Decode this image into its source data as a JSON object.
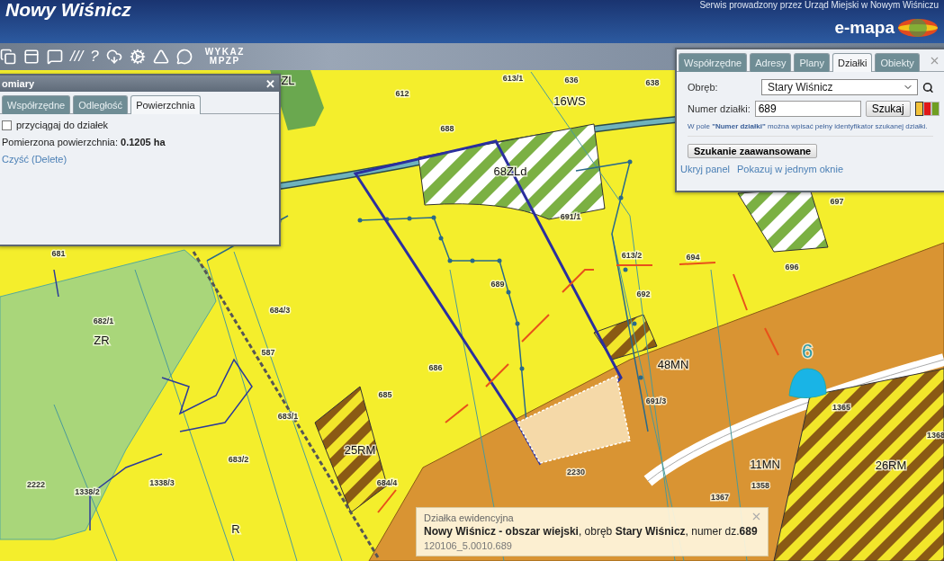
{
  "header": {
    "title": "Nowy Wiśnicz",
    "subtitle": "Serwis prowadzony przez Urząd Miejski w Nowym Wiśniczu",
    "logo": "e-mapa"
  },
  "toolbar": {
    "items": [
      {
        "kind": "icon"
      },
      {
        "kind": "icon"
      },
      {
        "kind": "icon"
      },
      {
        "kind": "glyph",
        "text": "///"
      },
      {
        "kind": "glyph",
        "text": "?"
      },
      {
        "kind": "icon"
      },
      {
        "kind": "icon"
      },
      {
        "kind": "icon"
      },
      {
        "kind": "icon"
      }
    ],
    "label": [
      "WYKAZ",
      "MPZP"
    ]
  },
  "measure_panel": {
    "title": "omiary",
    "close": "✕",
    "tabs": [
      {
        "label": "Współrzędne",
        "selected": false
      },
      {
        "label": "Odległość",
        "selected": false
      },
      {
        "label": "Powierzchnia",
        "selected": true
      }
    ],
    "snap": {
      "label": "przyciągaj do działek",
      "checked": false
    },
    "result": "Pomierzona powierzchnia: **0.1205 ha**",
    "clear_link": "Czyść (Delete)"
  },
  "search_panel": {
    "tabs": [
      {
        "label": "Współrzędne",
        "selected": false
      },
      {
        "label": "Adresy",
        "selected": false
      },
      {
        "label": "Plany",
        "selected": false
      },
      {
        "label": "Działki",
        "selected": true
      },
      {
        "label": "Obiekty",
        "selected": false
      }
    ],
    "district_label": "Obręb:",
    "district_value": "Stary Wiśnicz",
    "number_label": "Numer działki:",
    "number_value": "689",
    "search_button": "Szukaj",
    "color_options": [
      {
        "color": "#f2c23a",
        "selected": true
      },
      {
        "color": "#e01818",
        "selected": false
      },
      {
        "color": "#6f9e22",
        "selected": false
      }
    ],
    "hint": "W pole **\"Numer działki\"** można wpisać pełny identyfikator szukanej działki.",
    "advanced_button": "Szukanie zaawansowane",
    "links": [
      "Ukryj panel",
      "Pokazuj w jednym oknie"
    ]
  },
  "map": {
    "labels": [
      {
        "kind": "zone",
        "text": "ZL"
      },
      {
        "kind": "parcel",
        "text": "612"
      },
      {
        "kind": "parcel",
        "text": "613/1"
      },
      {
        "kind": "parcel",
        "text": "636"
      },
      {
        "kind": "parcel",
        "text": "638"
      },
      {
        "kind": "zone",
        "text": "16WS"
      },
      {
        "kind": "parcel",
        "text": "688"
      },
      {
        "kind": "zone",
        "text": "68ZLd"
      },
      {
        "kind": "parcel",
        "text": "691/1"
      },
      {
        "kind": "parcel",
        "text": "697"
      },
      {
        "kind": "parcel",
        "text": "613/2"
      },
      {
        "kind": "parcel",
        "text": "694"
      },
      {
        "kind": "parcel",
        "text": "696"
      },
      {
        "kind": "parcel",
        "text": "689"
      },
      {
        "kind": "parcel",
        "text": "692"
      },
      {
        "kind": "parcel",
        "text": "681"
      },
      {
        "kind": "parcel",
        "text": "682/1"
      },
      {
        "kind": "zone",
        "text": "ZR"
      },
      {
        "kind": "parcel",
        "text": "684/3"
      },
      {
        "kind": "parcel",
        "text": "587"
      },
      {
        "kind": "parcel",
        "text": "686"
      },
      {
        "kind": "parcel",
        "text": "685"
      },
      {
        "kind": "parcel",
        "text": "683/1"
      },
      {
        "kind": "zone",
        "text": "25RM"
      },
      {
        "kind": "parcel",
        "text": "683/2"
      },
      {
        "kind": "zone",
        "text": "48MN"
      },
      {
        "kind": "parcel",
        "text": "691/3"
      },
      {
        "kind": "parcel",
        "text": "1365"
      },
      {
        "kind": "parcel",
        "text": "1368"
      },
      {
        "kind": "zone",
        "text": "11MN"
      },
      {
        "kind": "zone",
        "text": "26RM"
      },
      {
        "kind": "parcel",
        "text": "2222"
      },
      {
        "kind": "parcel",
        "text": "1338/2"
      },
      {
        "kind": "parcel",
        "text": "1338/3"
      },
      {
        "kind": "parcel",
        "text": "684/4"
      },
      {
        "kind": "parcel",
        "text": "2230"
      },
      {
        "kind": "parcel",
        "text": "1358"
      },
      {
        "kind": "zone",
        "text": "R"
      },
      {
        "kind": "parcel",
        "text": "1367"
      },
      {
        "kind": "marker",
        "text": "6"
      }
    ]
  },
  "info_popup": {
    "title": "Działka ewidencyjna",
    "text": "**Nowy Wiśnicz - obszar wiejski**, obręb **Stary Wiśnicz**, numer dz.**689**",
    "id": "120106_5.0010.689"
  }
}
